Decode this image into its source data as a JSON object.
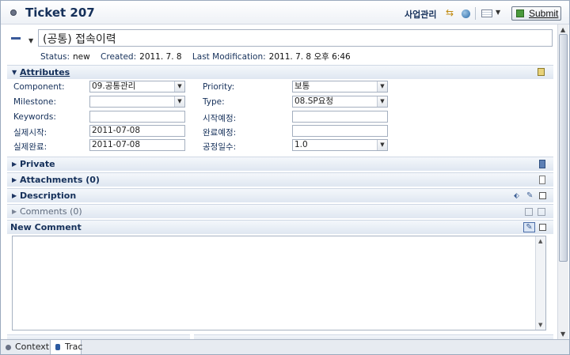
{
  "header": {
    "title": "Ticket 207",
    "connection": "사업관리",
    "submit_label": "Submit",
    "icons": [
      "ticket-icon",
      "sync-icon",
      "globe-icon",
      "view-menu-icon",
      "submit-icon"
    ]
  },
  "summary": {
    "value": "(공통) 접속이력"
  },
  "meta": {
    "status_label": "Status:",
    "status": "new",
    "created_label": "Created:",
    "created": "2011. 7. 8",
    "modified_label": "Last Modification:",
    "modified": "2011. 7. 8 오후 6:46"
  },
  "sections": {
    "attributes": "Attributes",
    "private": "Private",
    "attachments": "Attachments (0)",
    "description": "Description",
    "comments": "Comments (0)",
    "new_comment": "New Comment"
  },
  "attributes": {
    "component_label": "Component:",
    "component": "09.공통관리",
    "milestone_label": "Milestone:",
    "milestone": "",
    "keywords_label": "Keywords:",
    "keywords": "",
    "actual_start_label": "실제시작:",
    "actual_start": "2011-07-08",
    "actual_end_label": "실제완료:",
    "actual_end": "2011-07-08",
    "priority_label": "Priority:",
    "priority": "보통",
    "type_label": "Type:",
    "type": "08.SP요청",
    "planned_start_label": "시작예정:",
    "planned_start": "",
    "planned_end_label": "완료예정:",
    "planned_end": "",
    "effort_label": "공정일수:",
    "effort": "1.0"
  },
  "comment": {
    "value": ""
  },
  "bottom_tabs": [
    {
      "label": "Context"
    },
    {
      "label": "Trac"
    }
  ]
}
